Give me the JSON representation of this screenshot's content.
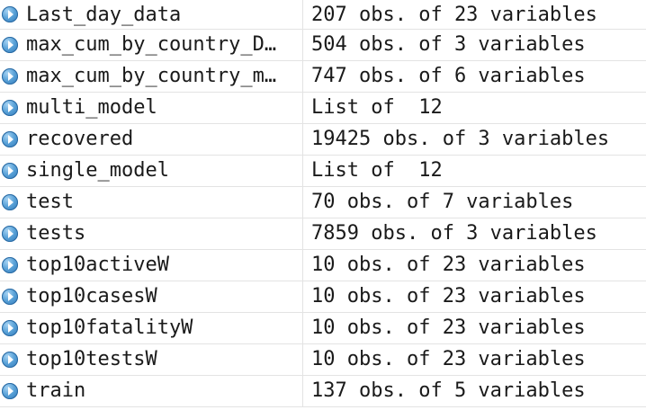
{
  "environment": {
    "rows": [
      {
        "name": "Last_day_data",
        "value": "207 obs. of 23 variables"
      },
      {
        "name": "max_cum_by_country_D…",
        "value": "504 obs. of 3 variables"
      },
      {
        "name": "max_cum_by_country_m…",
        "value": "747 obs. of 6 variables"
      },
      {
        "name": "multi_model",
        "value": "List of  12"
      },
      {
        "name": "recovered",
        "value": "19425 obs. of 3 variables"
      },
      {
        "name": "single_model",
        "value": "List of  12"
      },
      {
        "name": "test",
        "value": "70 obs. of 7 variables"
      },
      {
        "name": "tests",
        "value": "7859 obs. of 3 variables"
      },
      {
        "name": "top10activeW",
        "value": "10 obs. of 23 variables"
      },
      {
        "name": "top10casesW",
        "value": "10 obs. of 23 variables"
      },
      {
        "name": "top10fatalityW",
        "value": "10 obs. of 23 variables"
      },
      {
        "name": "top10testsW",
        "value": "10 obs. of 23 variables"
      },
      {
        "name": "train",
        "value": "137 obs. of 5 variables"
      }
    ]
  },
  "icons": {
    "expander": "expand-arrow-icon"
  },
  "colors": {
    "expander_fill": "#3b86c6",
    "row_border": "#e3e3e3",
    "text": "#1a1a1a"
  }
}
